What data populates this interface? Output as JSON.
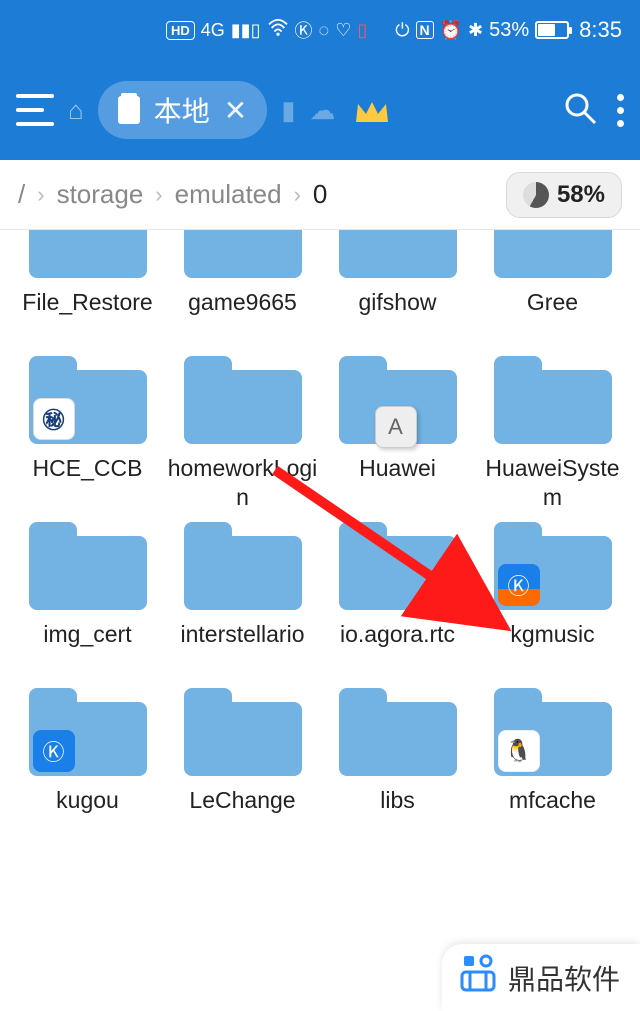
{
  "status": {
    "hd": "HD",
    "net": "4G",
    "battery_pct": "53%",
    "time": "8:35"
  },
  "tab": {
    "label": "本地"
  },
  "breadcrumb": {
    "p1": "/",
    "p2": "storage",
    "p3": "emulated",
    "p4": "0"
  },
  "disk": {
    "pct": "58%"
  },
  "folders": [
    {
      "name": "File_Restore",
      "badge": null,
      "cut": true
    },
    {
      "name": "game9665",
      "badge": null,
      "cut": true
    },
    {
      "name": "gifshow",
      "badge": null,
      "cut": true
    },
    {
      "name": "Gree",
      "badge": null,
      "cut": true
    },
    {
      "name": "HCE_CCB",
      "badge": "ccb"
    },
    {
      "name": "homeworkLogin",
      "badge": null
    },
    {
      "name": "Huawei",
      "badge": "a"
    },
    {
      "name": "HuaweiSystem",
      "badge": null
    },
    {
      "name": "img_cert",
      "badge": null
    },
    {
      "name": "interstellario",
      "badge": null
    },
    {
      "name": "io.agora.rtc",
      "badge": null
    },
    {
      "name": "kgmusic",
      "badge": "kg2"
    },
    {
      "name": "kugou",
      "badge": "kg"
    },
    {
      "name": "LeChange",
      "badge": null
    },
    {
      "name": "libs",
      "badge": null
    },
    {
      "name": "mfcache",
      "badge": "qq"
    }
  ],
  "watermark": {
    "text": "鼎品软件"
  }
}
